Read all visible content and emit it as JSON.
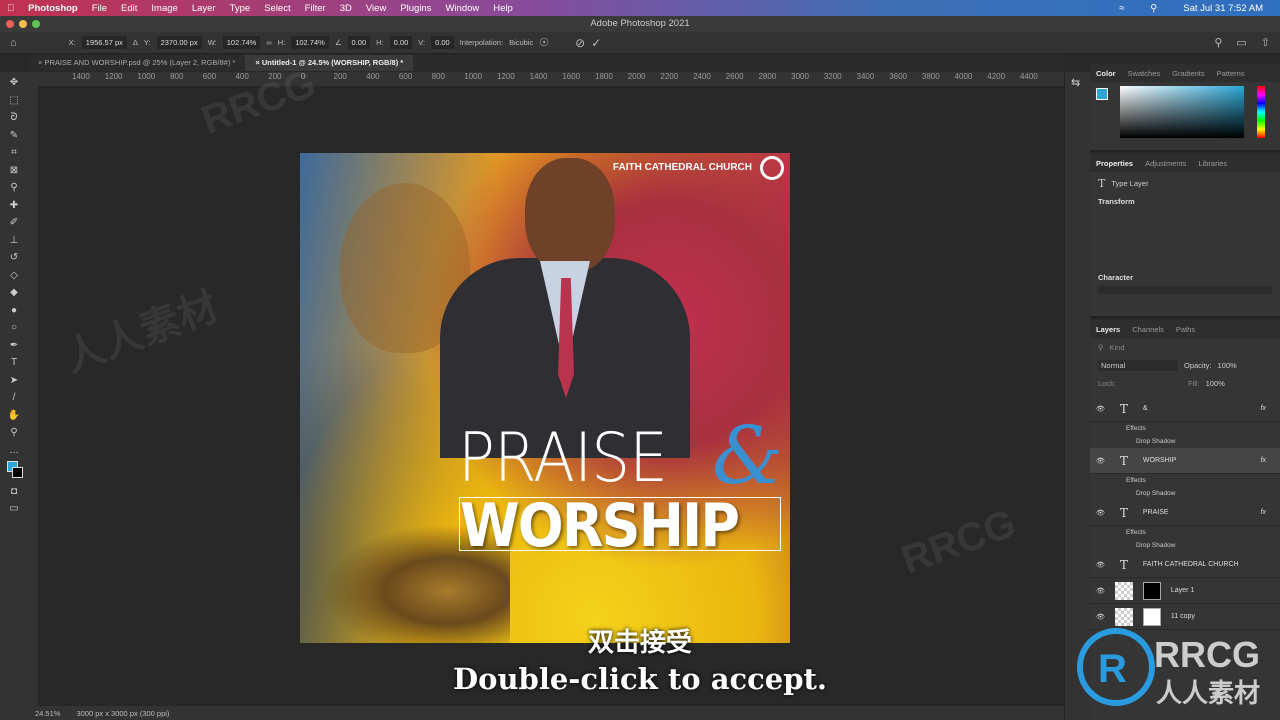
{
  "menubar": {
    "app": "Photoshop",
    "items": [
      "File",
      "Edit",
      "Image",
      "Layer",
      "Type",
      "Select",
      "Filter",
      "3D",
      "View",
      "Plugins",
      "Window",
      "Help"
    ],
    "datetime": "Sat Jul 31  7:52 AM"
  },
  "window": {
    "title": "Adobe Photoshop 2021"
  },
  "options": {
    "x_label": "X:",
    "x": "1956.57 px",
    "y_label": "Y:",
    "y": "2370.00 px",
    "w_label": "W:",
    "w": "102.74%",
    "h_label": "H:",
    "h": "102.74%",
    "angle": "0.00",
    "hskew_label": "H:",
    "hskew": "0.00",
    "vskew_label": "V:",
    "vskew": "0.00",
    "interp_label": "Interpolation:",
    "interp": "Bicubic"
  },
  "tabs": [
    {
      "label": "PRAISE AND WORSHIP.psd @ 25% (Layer 2, RGB/8#) *"
    },
    {
      "label": "Untitled-1 @ 24.5% (WORSHIP, RGB/8) *"
    }
  ],
  "ruler": [
    "1400",
    "1200",
    "1000",
    "800",
    "600",
    "400",
    "200",
    "0",
    "200",
    "400",
    "600",
    "800",
    "1000",
    "1200",
    "1400",
    "1600",
    "1800",
    "2000",
    "2200",
    "2400",
    "2600",
    "2800",
    "3000",
    "3200",
    "3400",
    "3600",
    "3800",
    "4000",
    "4200",
    "4400"
  ],
  "poster": {
    "church": "FAITH CATHEDRAL CHURCH",
    "praise": "PRAISE",
    "amp": "&",
    "worship": "WORSHIP"
  },
  "subtitles": {
    "cn": "双击接受",
    "en": "Double-click to accept."
  },
  "status": {
    "zoom": "24.51%",
    "doc": "3000 px x 3000 px (300 ppi)"
  },
  "color_panel": {
    "tabs": [
      "Color",
      "Swatches",
      "Gradients",
      "Patterns"
    ],
    "fg": "#2ba6d6"
  },
  "properties": {
    "tabs": [
      "Properties",
      "Adjustments",
      "Libraries"
    ],
    "kind": "Type Layer",
    "transform": "Transform",
    "character": "Character"
  },
  "layers_panel": {
    "tabs": [
      "Layers",
      "Channels",
      "Paths"
    ],
    "filter": "Kind",
    "blend": "Normal",
    "opacity_label": "Opacity:",
    "opacity": "100%",
    "lock_label": "Lock:",
    "fill_label": "Fill:",
    "fill": "100%",
    "layers": [
      {
        "name": "&",
        "type": "text",
        "fx": "fx"
      },
      {
        "name": "WORSHIP",
        "type": "text",
        "fx": "fx",
        "selected": true
      },
      {
        "name": "PRAISE",
        "type": "text",
        "fx": "fx"
      },
      {
        "name": "FAITH CATHEDRAL CHURCH",
        "type": "text"
      },
      {
        "name": "Layer 1",
        "type": "pixel"
      },
      {
        "name": "11 copy",
        "type": "pixel"
      }
    ],
    "effects": "Effects",
    "drop_shadow": "Drop Shadow"
  },
  "watermark": "RRCG 人人素材"
}
